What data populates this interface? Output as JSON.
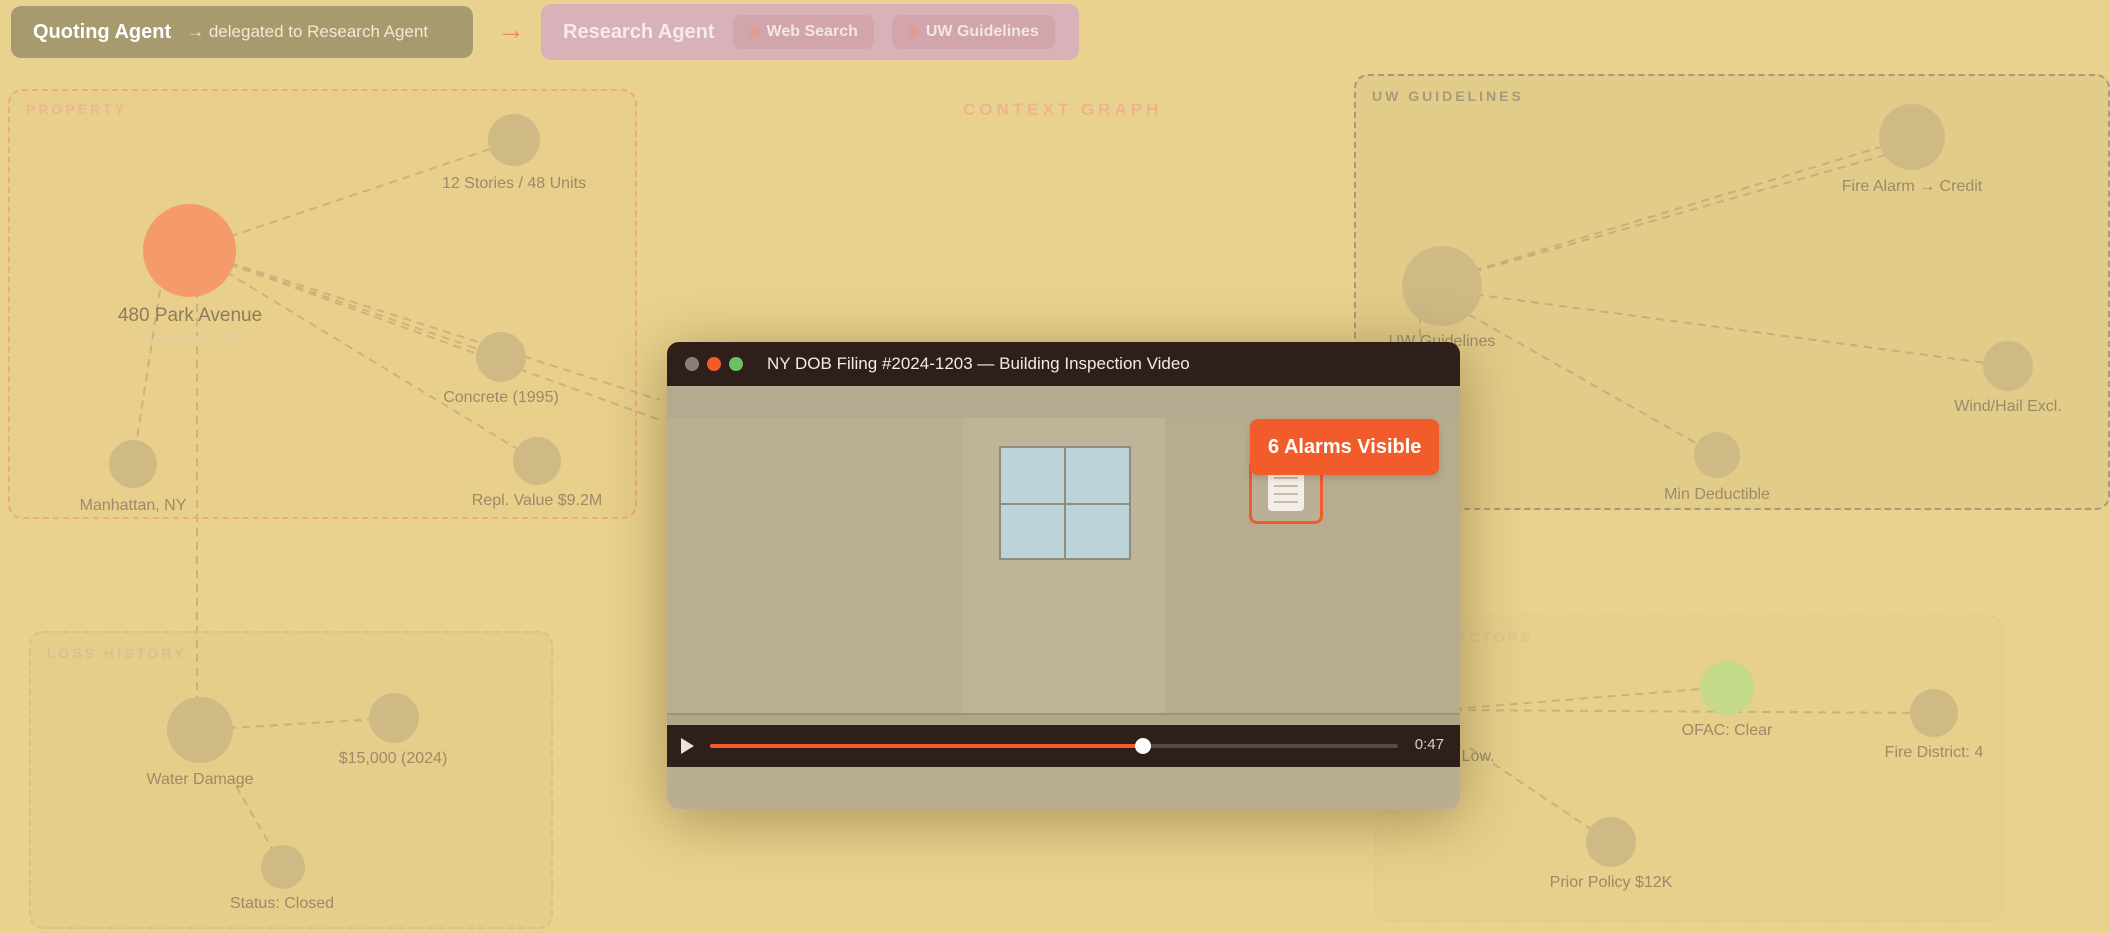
{
  "top_bar": {
    "quoting_agent": "Quoting Agent",
    "delegation": "→ delegated to Research Agent",
    "arrow": "→",
    "research_agent": "Research Agent",
    "tools": [
      "Web Search",
      "UW Guidelines"
    ]
  },
  "graph_title": "CONTEXT GRAPH",
  "groups": {
    "property": "PROPERTY",
    "uw_guidelines": "UW GUIDELINES",
    "loss_history": "LOSS HISTORY",
    "risk_factors": "RISK FACTORS"
  },
  "nodes": {
    "property_main": "480 Park Avenue",
    "property_main_sub": "New York, NY",
    "stories": "12 Stories / 48 Units",
    "concrete": "Concrete (1995)",
    "replacement": "Repl. Value $9.2M",
    "manhattan": "Manhattan, NY",
    "fire_alarm": "Fire Alarm → Credit",
    "uw_hub": "UW Guidelines",
    "wind_hail": "Wind/Hail Excl.",
    "min_deductible": "Min Deductible",
    "water_damage": "Water Damage",
    "loss_amount": "$15,000 (2024)",
    "status": "Status: Closed",
    "ofac": "OFAC: Clear",
    "fire_district": "Fire District: 4",
    "risk_low": "Low.",
    "prior_policy": "Prior Policy $12K"
  },
  "video": {
    "title": "NY DOB Filing #2024-1203 — Building Inspection Video",
    "badge": "6 Alarms Visible",
    "progress": 0.63,
    "time": "0:47"
  },
  "colors": {
    "background": "#e8d28d",
    "accent": "#f25c2b",
    "property_node": "#f59b6a",
    "ofac_node": "#c4d98a"
  },
  "icons": {
    "play": "play-icon",
    "alarm": "fire-alarm-icon"
  }
}
